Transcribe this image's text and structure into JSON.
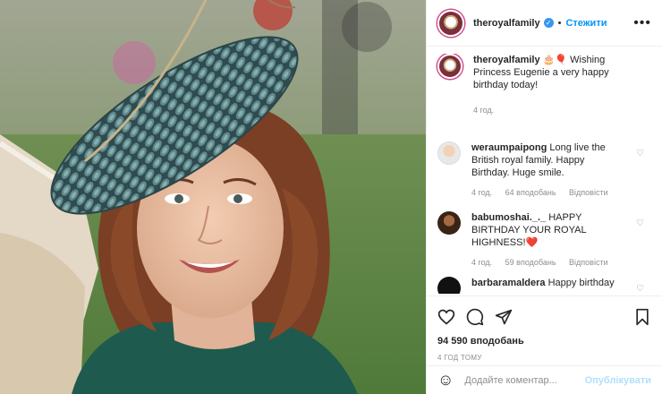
{
  "header": {
    "username": "theroyalfamily",
    "verified_symbol": "✓",
    "follow_label": "Стежити",
    "more_symbol": "•••"
  },
  "caption": {
    "username": "theroyalfamily",
    "emoji": "🎂🎈",
    "text": " Wishing Princess Eugenie a very happy birthday today!",
    "time": "4 год."
  },
  "comments": [
    {
      "username": "weraumpaipong",
      "text": " Long live the British royal family. Happy Birthday. Huge smile.",
      "time": "4 год.",
      "likes": "64 вподобань",
      "reply": "Відповісти"
    },
    {
      "username": "babumoshai._._",
      "text": " HAPPY BIRTHDAY YOUR ROYAL HIGHNESS!❤️",
      "time": "4 год.",
      "likes": "59 вподобань",
      "reply": "Відповісти"
    },
    {
      "username": "barbaramaldera",
      "text": " Happy birthday"
    }
  ],
  "actions": {
    "likes_count": "94 590 вподобань",
    "posted_ago": "4 ГОД ТОМУ"
  },
  "add_comment": {
    "emoji": "☺",
    "placeholder": "Додайте коментар...",
    "post_label": "Опублікувати"
  },
  "icons": [
    "heart-icon",
    "comment-icon",
    "share-icon",
    "bookmark-icon",
    "smile-icon",
    "more-icon"
  ],
  "colors": {
    "link": "#0095f6",
    "verified": "#3897f0",
    "muted": "#8e8e8e",
    "post_disabled": "#b2dffc",
    "heart": "#e0245e"
  }
}
